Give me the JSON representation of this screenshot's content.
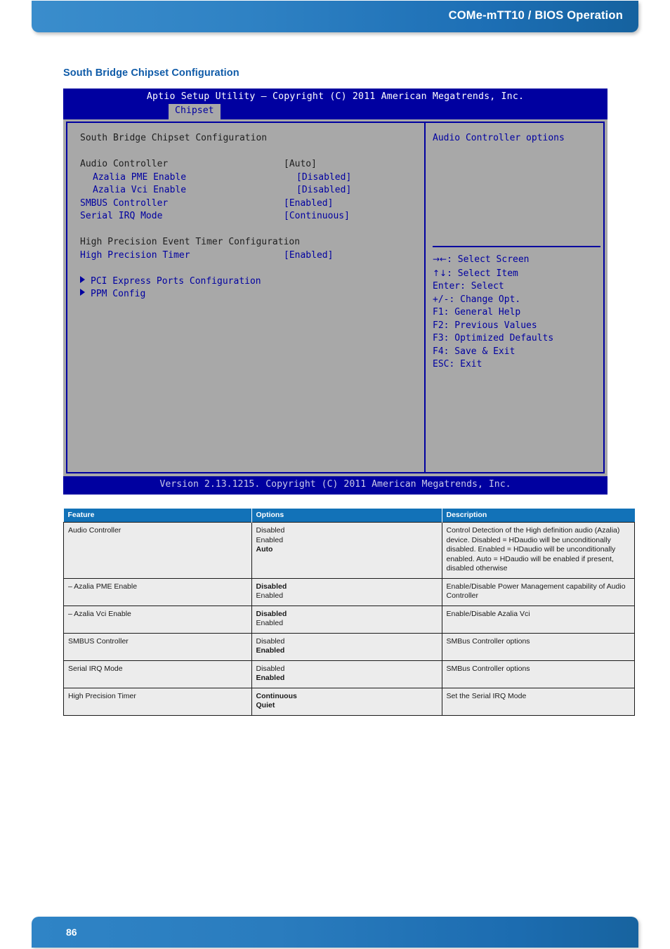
{
  "header": {
    "title": "COMe-mTT10 / BIOS Operation"
  },
  "section": {
    "heading": "South Bridge Chipset Configuration"
  },
  "bios": {
    "title": "Aptio Setup Utility – Copyright (C) 2011 American Megatrends, Inc.",
    "tab": "Chipset",
    "screen_heading": "South Bridge Chipset Configuration",
    "settings": [
      {
        "label": "Audio Controller",
        "value": "[Auto]"
      },
      {
        "label": "Azalia PME Enable",
        "value": "[Disabled]"
      },
      {
        "label": "Azalia Vci Enable",
        "value": "[Disabled]"
      },
      {
        "label": "SMBUS Controller",
        "value": "[Enabled]"
      },
      {
        "label": "Serial IRQ Mode",
        "value": "[Continuous]"
      }
    ],
    "hpet_heading": "High Precision Event Timer Configuration",
    "hpet": {
      "label": "High Precision Timer",
      "value": "[Enabled]"
    },
    "submenus": [
      "PCI Express Ports Configuration",
      "PPM Config"
    ],
    "help": "Audio Controller options",
    "keys": [
      {
        "glyph": "→←",
        "text": ": Select Screen"
      },
      {
        "glyph": "↑↓",
        "text": ": Select Item"
      },
      {
        "glyph": "",
        "text": "Enter: Select"
      },
      {
        "glyph": "",
        "text": "+/-: Change Opt."
      },
      {
        "glyph": "",
        "text": "F1: General Help"
      },
      {
        "glyph": "",
        "text": "F2: Previous Values"
      },
      {
        "glyph": "",
        "text": "F3: Optimized Defaults"
      },
      {
        "glyph": "",
        "text": "F4: Save & Exit"
      },
      {
        "glyph": "",
        "text": "ESC: Exit"
      }
    ],
    "version": "Version 2.13.1215. Copyright (C) 2011 American Megatrends, Inc."
  },
  "table": {
    "columns": [
      "Feature",
      "Options",
      "Description"
    ],
    "rows": [
      {
        "feature": "Audio Controller",
        "options": [
          {
            "text": "Disabled",
            "bold": false
          },
          {
            "text": "Enabled",
            "bold": false
          },
          {
            "text": "Auto",
            "bold": true
          }
        ],
        "description": "Control Detection of the High definition audio (Azalia) device. Disabled = HDaudio will be unconditionally disabled. Enabled = HDaudio will be unconditionally enabled. Auto = HDaudio will be enabled if present, disabled otherwise"
      },
      {
        "feature": "– Azalia PME Enable",
        "options": [
          {
            "text": "Disabled",
            "bold": true
          },
          {
            "text": "Enabled",
            "bold": false
          }
        ],
        "description": "Enable/Disable Power Management capability of Audio Controller"
      },
      {
        "feature": "– Azalia Vci Enable",
        "options": [
          {
            "text": "Disabled",
            "bold": true
          },
          {
            "text": "Enabled",
            "bold": false
          }
        ],
        "description": "Enable/Disable Azalia Vci"
      },
      {
        "feature": "SMBUS Controller",
        "options": [
          {
            "text": "Disabled",
            "bold": false
          },
          {
            "text": "Enabled",
            "bold": true
          }
        ],
        "description": "SMBus Controller options"
      },
      {
        "feature": "Serial IRQ Mode",
        "options": [
          {
            "text": "Disabled",
            "bold": false
          },
          {
            "text": "Enabled",
            "bold": true
          }
        ],
        "description": "SMBus Controller options"
      },
      {
        "feature": "High Precision Timer",
        "options": [
          {
            "text": "Continuous",
            "bold": true
          },
          {
            "text": "Quiet",
            "bold": true
          }
        ],
        "description": "Set the Serial IRQ Mode"
      }
    ]
  },
  "footer": {
    "page_number": "86"
  },
  "colors": {
    "brand_blue": "#1272b8",
    "heading_blue": "#0f5ba8",
    "bios_blue": "#0000a0",
    "bios_gray": "#a8a8a8"
  }
}
